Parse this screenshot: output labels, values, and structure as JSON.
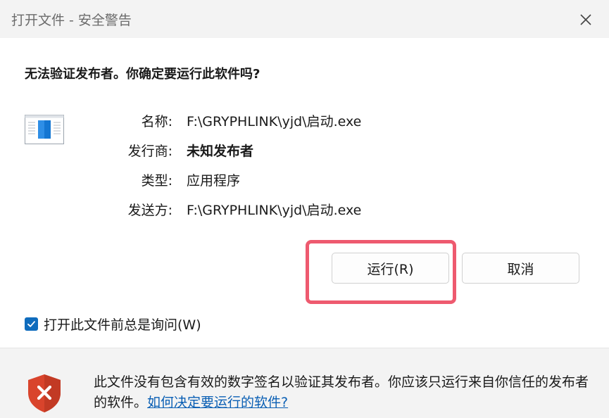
{
  "window": {
    "title": "打开文件 - 安全警告"
  },
  "question": "无法验证发布者。你确定要运行此软件吗?",
  "file_info": [
    {
      "label": "名称:",
      "value": "F:\\GRYPHLINK\\yjd\\启动.exe",
      "bold": false
    },
    {
      "label": "发行商:",
      "value": "未知发布者",
      "bold": true
    },
    {
      "label": "类型:",
      "value": "应用程序",
      "bold": false
    },
    {
      "label": "发送方:",
      "value": "F:\\GRYPHLINK\\yjd\\启动.exe",
      "bold": false
    }
  ],
  "buttons": {
    "run_label": "运行(R)",
    "cancel_label": "取消"
  },
  "checkbox": {
    "label": "打开此文件前总是询问(W)",
    "checked": true
  },
  "footer": {
    "warning_text": "此文件没有包含有效的数字签名以验证其发布者。你应该只运行来自你信任的发布者的软件。",
    "link_text": "如何决定要运行的软件?"
  },
  "colors": {
    "accent": "#0f6cbd",
    "highlight": "#ee5a6f",
    "shield": "#d9442c",
    "link": "#0a5fb4"
  },
  "icons": {
    "close": "close-icon",
    "file": "application-file-icon",
    "shield": "shield-warning-icon",
    "check": "checkmark-icon"
  }
}
